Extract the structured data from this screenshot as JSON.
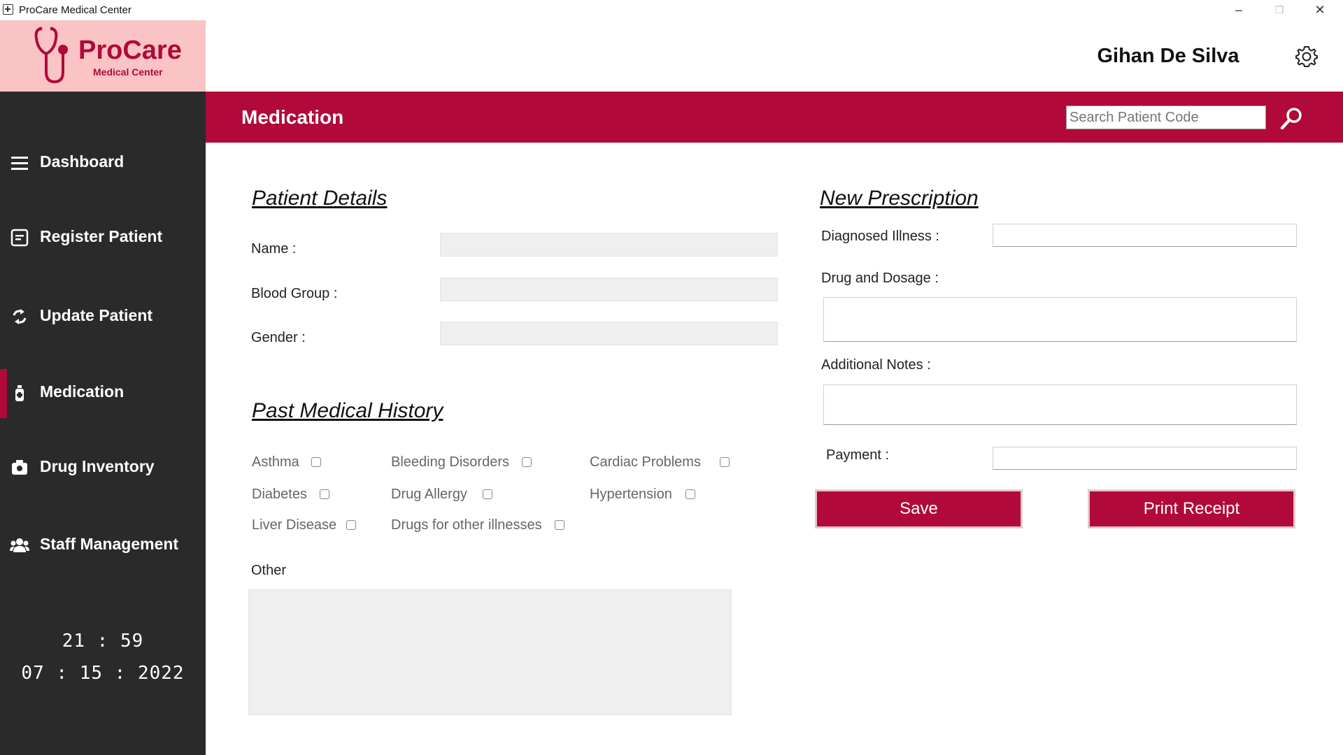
{
  "window": {
    "title": "ProCare Medical Center"
  },
  "logo": {
    "brand": "ProCare",
    "sub": "Medical Center"
  },
  "user": {
    "name": "Gihan De Silva"
  },
  "nav": {
    "items": [
      {
        "label": "Dashboard",
        "icon": "menu-icon"
      },
      {
        "label": "Register Patient",
        "icon": "register-icon"
      },
      {
        "label": "Update Patient",
        "icon": "refresh-icon"
      },
      {
        "label": "Medication",
        "icon": "medication-icon",
        "active": true
      },
      {
        "label": "Drug Inventory",
        "icon": "camera-box-icon"
      },
      {
        "label": "Staff Management",
        "icon": "users-icon"
      }
    ]
  },
  "clock": {
    "time": "21 : 59",
    "date": "07 : 15 : 2022"
  },
  "header": {
    "title": "Medication",
    "search_placeholder": "Search Patient Code"
  },
  "patient_details": {
    "heading": "Patient Details",
    "name_label": "Name :",
    "blood_label": "Blood Group :",
    "gender_label": "Gender :"
  },
  "history": {
    "heading": "Past Medical History",
    "conditions": [
      "Asthma",
      "Bleeding Disorders",
      "Cardiac Problems",
      "Diabetes",
      "Drug Allergy",
      "Hypertension",
      "Liver Disease",
      "Drugs for other illnesses"
    ],
    "other_label": "Other"
  },
  "prescription": {
    "heading": "New Prescription",
    "illness_label": "Diagnosed Illness :",
    "drug_label": "Drug and Dosage :",
    "notes_label": "Additional Notes :",
    "payment_label": "Payment :",
    "save_label": "Save",
    "print_label": "Print Receipt"
  },
  "colors": {
    "accent": "#b0093a",
    "sidebar": "#2b2a2b",
    "logo_bg": "#fbc4c4"
  }
}
